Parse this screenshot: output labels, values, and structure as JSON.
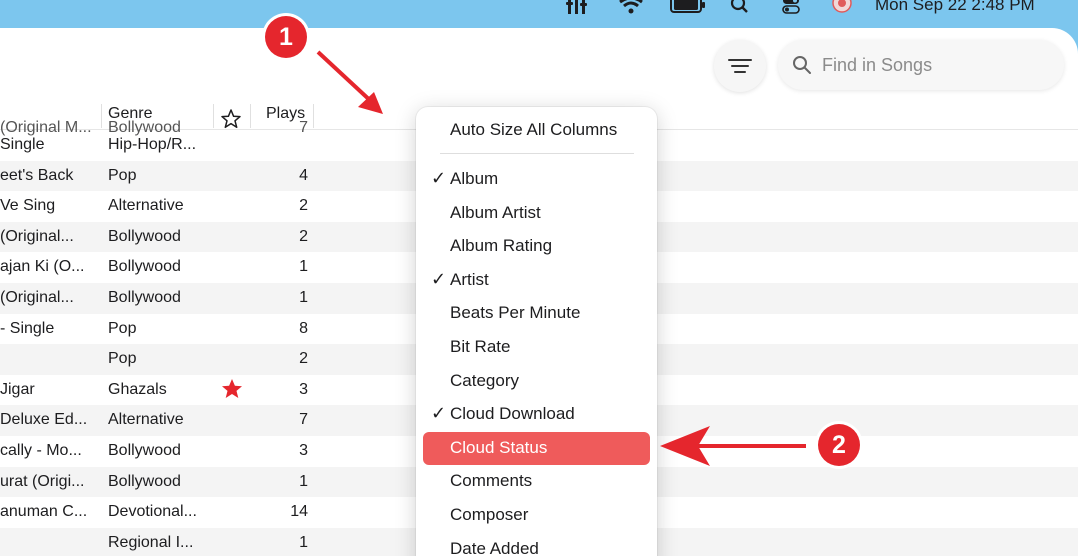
{
  "menubar": {
    "clock": "Mon Sep 22  2:48 PM",
    "icons": [
      "equalizer-icon",
      "wifi-icon",
      "battery-icon",
      "search-icon",
      "control-center-icon",
      "user-icon"
    ]
  },
  "toolbar": {
    "filter_icon": "filter-lines-icon",
    "search": {
      "placeholder": "Find in Songs",
      "value": ""
    }
  },
  "table": {
    "columns": {
      "genre": "Genre",
      "star": "star-icon",
      "plays": "Plays"
    },
    "partial_first_row": {
      "album": "(Original M...",
      "genre": "Bollywood",
      "plays": "7"
    },
    "rows": [
      {
        "album": "Single",
        "genre": "Hip-Hop/R...",
        "plays": "",
        "loved": false
      },
      {
        "album": "eet's Back",
        "genre": "Pop",
        "plays": "4",
        "loved": false
      },
      {
        "album": "Ve Sing",
        "genre": "Alternative",
        "plays": "2",
        "loved": false
      },
      {
        "album": "(Original...",
        "genre": "Bollywood",
        "plays": "2",
        "loved": false
      },
      {
        "album": "ajan Ki (O...",
        "genre": "Bollywood",
        "plays": "1",
        "loved": false
      },
      {
        "album": "(Original...",
        "genre": "Bollywood",
        "plays": "1",
        "loved": false
      },
      {
        "album": "- Single",
        "genre": "Pop",
        "plays": "8",
        "loved": false
      },
      {
        "album": "",
        "genre": "Pop",
        "plays": "2",
        "loved": false
      },
      {
        "album": "Jigar",
        "genre": "Ghazals",
        "plays": "3",
        "loved": true
      },
      {
        "album": "Deluxe Ed...",
        "genre": "Alternative",
        "plays": "7",
        "loved": false
      },
      {
        "album": "cally - Mo...",
        "genre": "Bollywood",
        "plays": "3",
        "loved": false
      },
      {
        "album": "urat (Origi...",
        "genre": "Bollywood",
        "plays": "1",
        "loved": false
      },
      {
        "album": "anuman C...",
        "genre": "Devotional...",
        "plays": "14",
        "loved": false
      },
      {
        "album": "",
        "genre": "Regional I...",
        "plays": "1",
        "loved": false
      }
    ]
  },
  "context_menu": {
    "header_item": "Auto Size All Columns",
    "items": [
      {
        "label": "Album",
        "checked": true,
        "selected": false
      },
      {
        "label": "Album Artist",
        "checked": false,
        "selected": false
      },
      {
        "label": "Album Rating",
        "checked": false,
        "selected": false
      },
      {
        "label": "Artist",
        "checked": true,
        "selected": false
      },
      {
        "label": "Beats Per Minute",
        "checked": false,
        "selected": false
      },
      {
        "label": "Bit Rate",
        "checked": false,
        "selected": false
      },
      {
        "label": "Category",
        "checked": false,
        "selected": false
      },
      {
        "label": "Cloud Download",
        "checked": true,
        "selected": false
      },
      {
        "label": "Cloud Status",
        "checked": false,
        "selected": true
      },
      {
        "label": "Comments",
        "checked": false,
        "selected": false
      },
      {
        "label": "Composer",
        "checked": false,
        "selected": false
      },
      {
        "label": "Date Added",
        "checked": false,
        "selected": false
      }
    ],
    "check_glyph": "✓"
  },
  "annotations": {
    "badge1": "1",
    "badge2": "2",
    "color": "#e5262d"
  },
  "colors": {
    "accent_selection": "#ef5b5b",
    "loved_star": "#e5262d",
    "desktop": "#7cc6ee"
  }
}
